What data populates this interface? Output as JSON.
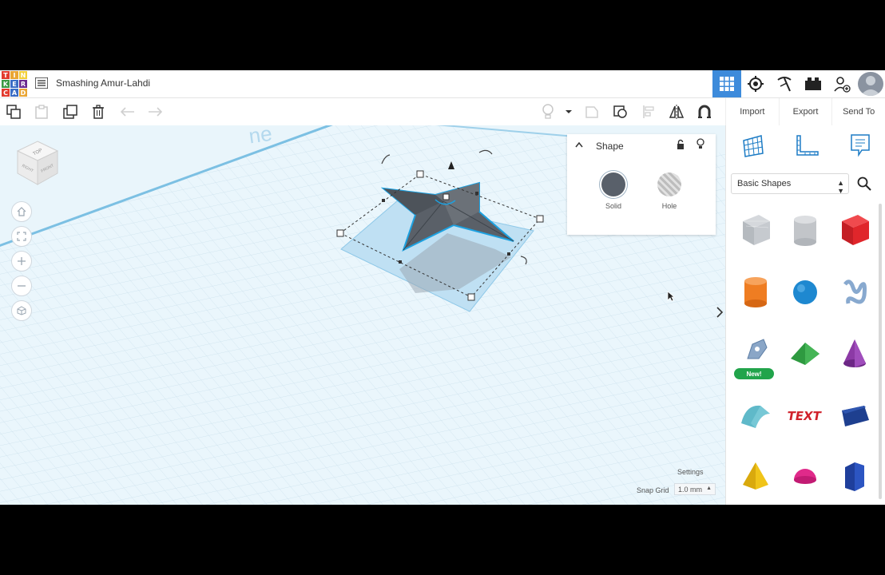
{
  "app": {
    "logo_letters": [
      "T",
      "I",
      "N",
      "K",
      "E",
      "R",
      "C",
      "A",
      "D"
    ],
    "logo_colors": [
      "#e23b2e",
      "#e9a534",
      "#f2cf3a",
      "#3c9a44",
      "#3a6cc5",
      "#6d2b90",
      "#e23b2e",
      "#3a6cc5",
      "#e9a534"
    ],
    "title": "Smashing Amur-Lahdi",
    "accent": "#3d8bdb"
  },
  "topbar": {
    "icons": [
      "grid-view-icon",
      "lightbulb-gear-icon",
      "pickaxe-icon",
      "bricks-icon",
      "add-user-icon",
      "avatar"
    ]
  },
  "toolbar": {
    "icons": [
      "copy-icon",
      "paste-icon",
      "duplicate-icon",
      "delete-icon",
      "undo-icon",
      "redo-icon"
    ],
    "right_icons": [
      "light-icon",
      "dropdown-icon",
      "group-icon",
      "ungroup-icon",
      "align-icon",
      "mirror-icon",
      "magnet-icon"
    ]
  },
  "actions": {
    "import": "Import",
    "export": "Export",
    "send_to": "Send To"
  },
  "viewcube": {
    "top": "TOP",
    "right": "RIGHT",
    "front": "FRONT"
  },
  "shape_panel": {
    "title": "Shape",
    "solid_label": "Solid",
    "hole_label": "Hole",
    "solid_color": "#59606a",
    "hole_color": "#c8c8c8"
  },
  "workspace": {
    "plane_text": "ne",
    "settings_label": "Settings",
    "snap_grid_label": "Snap Grid",
    "snap_grid_value": "1.0 mm"
  },
  "sidebar": {
    "category": "Basic Shapes",
    "new_badge": "New!",
    "shapes": [
      {
        "name": "box-hole",
        "color": "#b7bcc2"
      },
      {
        "name": "cylinder-hole",
        "color": "#c2c5c9"
      },
      {
        "name": "box",
        "color": "#e0262b"
      },
      {
        "name": "cylinder",
        "color": "#ef7d22"
      },
      {
        "name": "sphere",
        "color": "#1e88d0"
      },
      {
        "name": "scribble",
        "color": "#88a9cf"
      },
      {
        "name": "shape-generator",
        "color": "#8aa6c7"
      },
      {
        "name": "roof",
        "color": "#2e9a40"
      },
      {
        "name": "cone",
        "color": "#8c3aa6"
      },
      {
        "name": "round-roof",
        "color": "#5fb9c9"
      },
      {
        "name": "text",
        "color": "#d0202a"
      },
      {
        "name": "wedge",
        "color": "#1e3f8f"
      },
      {
        "name": "pyramid",
        "color": "#f0c419"
      },
      {
        "name": "half-sphere",
        "color": "#e02a8a"
      },
      {
        "name": "polygon",
        "color": "#1f3f9c"
      }
    ]
  }
}
